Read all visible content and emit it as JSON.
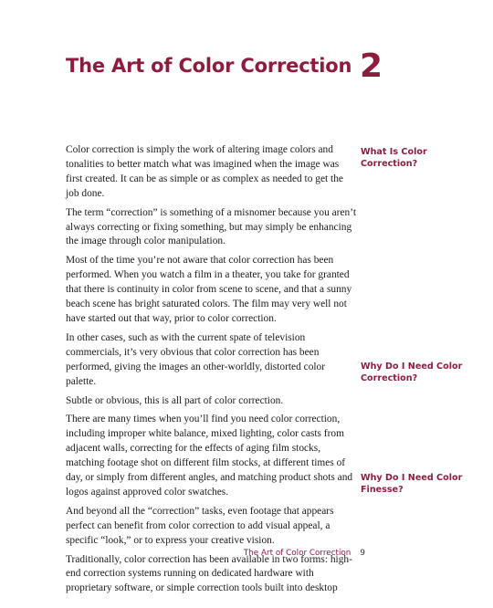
{
  "chapter": {
    "title": "The Art of Color Correction",
    "number": "2"
  },
  "body": {
    "paragraphs": [
      "Color correction is simply the work of altering image colors and tonalities to better match what was imagined when the image was first created. It can be as simple or as complex as needed to get the job done.",
      "The term “correction” is something of a misnomer because you aren’t always correcting or fixing something, but may simply be enhancing the image through color manipulation.",
      "Most of the time you’re not aware that color correction has been performed. When you watch a film in a theater, you take for granted that there is continuity in color from scene to scene, and that a sunny beach scene has bright saturated colors. The film may very well not have started out that way, prior to color correction.",
      "In other cases, such as with the current spate of television commercials, it’s very obvious that color correction has been performed, giving the images an other-worldly, distorted color palette.",
      "Subtle or obvious, this is all part of color correction.",
      "There are many times when you’ll find you need color correction, including improper white balance, mixed lighting, color casts from adjacent walls, correcting for the effects of aging film stocks, matching footage shot on different film stocks, at different times of day, or simply from different angles, and matching product shots and logos against approved color swatches.",
      "And beyond all the “correction” tasks, even footage that appears perfect can benefit from color correction to add visual appeal, a specific “look,” or to express your creative vision.",
      "Traditionally, color correction has been available in two forms: high-end correction systems running on dedicated hardware with proprietary software, or simple correction tools built into desktop"
    ]
  },
  "sideheads": [
    "What Is Color Correction?",
    "Why Do I Need Color Correction?",
    "Why Do I Need Color Finesse?"
  ],
  "footer": {
    "running_head": "The Art of Color Correction",
    "page_number": "9"
  }
}
